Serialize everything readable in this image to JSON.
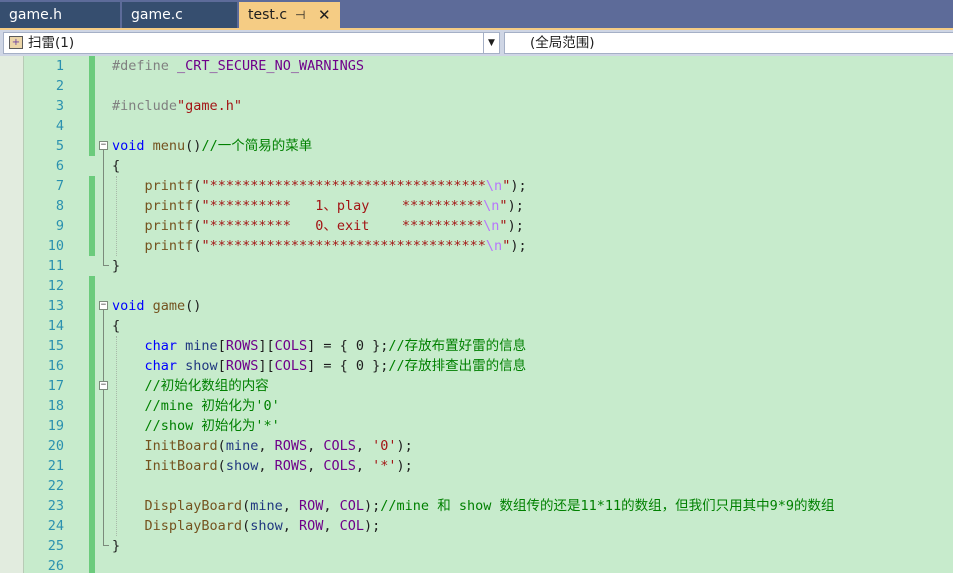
{
  "tabs": [
    {
      "label": "game.h",
      "state": "inactive"
    },
    {
      "label": "game.c",
      "state": "inactive"
    },
    {
      "label": "test.c",
      "state": "active"
    }
  ],
  "tab_icons": {
    "pin": "pin-icon",
    "close": "close-icon"
  },
  "nav": {
    "project_scope": "扫雷(1)",
    "member_scope": "(全局范围)"
  },
  "colors": {
    "tab_bar": "#5d6b99",
    "active_tab": "#f5cc84",
    "editor_background": "#c7ebcc",
    "line_number": "#2b91af",
    "keyword": "#0000ff",
    "string": "#a31515",
    "comment": "#008000",
    "macro": "#6f008a",
    "change_marker": "#6bcb7c"
  },
  "editor": {
    "lines": [
      {
        "n": "1",
        "changed": true,
        "tokens": [
          {
            "t": "#define ",
            "c": "pp"
          },
          {
            "t": "_CRT_SECURE_NO_WARNINGS",
            "c": "mac"
          }
        ]
      },
      {
        "n": "2",
        "changed": true,
        "tokens": []
      },
      {
        "n": "3",
        "changed": true,
        "tokens": [
          {
            "t": "#include",
            "c": "pp"
          },
          {
            "t": "\"game.h\"",
            "c": "str"
          }
        ]
      },
      {
        "n": "4",
        "changed": true,
        "tokens": []
      },
      {
        "n": "5",
        "changed": true,
        "tokens": [
          {
            "t": "void",
            "c": "kw"
          },
          {
            "t": " ",
            "c": "pl"
          },
          {
            "t": "menu",
            "c": "fn"
          },
          {
            "t": "()",
            "c": "pl"
          },
          {
            "t": "//一个简易的菜单",
            "c": "cm"
          }
        ]
      },
      {
        "n": "6",
        "changed": false,
        "tokens": [
          {
            "t": "{",
            "c": "pl"
          }
        ]
      },
      {
        "n": "7",
        "changed": true,
        "tokens": [
          {
            "t": "    ",
            "c": "pl"
          },
          {
            "t": "printf",
            "c": "fn"
          },
          {
            "t": "(",
            "c": "pl"
          },
          {
            "t": "\"**********************************",
            "c": "str"
          },
          {
            "t": "\\n",
            "c": "esc"
          },
          {
            "t": "\"",
            "c": "str"
          },
          {
            "t": ");",
            "c": "pl"
          }
        ]
      },
      {
        "n": "8",
        "changed": true,
        "tokens": [
          {
            "t": "    ",
            "c": "pl"
          },
          {
            "t": "printf",
            "c": "fn"
          },
          {
            "t": "(",
            "c": "pl"
          },
          {
            "t": "\"**********   1、play    **********",
            "c": "str"
          },
          {
            "t": "\\n",
            "c": "esc"
          },
          {
            "t": "\"",
            "c": "str"
          },
          {
            "t": ");",
            "c": "pl"
          }
        ]
      },
      {
        "n": "9",
        "changed": true,
        "tokens": [
          {
            "t": "    ",
            "c": "pl"
          },
          {
            "t": "printf",
            "c": "fn"
          },
          {
            "t": "(",
            "c": "pl"
          },
          {
            "t": "\"**********   0、exit    **********",
            "c": "str"
          },
          {
            "t": "\\n",
            "c": "esc"
          },
          {
            "t": "\"",
            "c": "str"
          },
          {
            "t": ");",
            "c": "pl"
          }
        ]
      },
      {
        "n": "10",
        "changed": true,
        "tokens": [
          {
            "t": "    ",
            "c": "pl"
          },
          {
            "t": "printf",
            "c": "fn"
          },
          {
            "t": "(",
            "c": "pl"
          },
          {
            "t": "\"**********************************",
            "c": "str"
          },
          {
            "t": "\\n",
            "c": "esc"
          },
          {
            "t": "\"",
            "c": "str"
          },
          {
            "t": ");",
            "c": "pl"
          }
        ]
      },
      {
        "n": "11",
        "changed": false,
        "tokens": [
          {
            "t": "}",
            "c": "pl"
          }
        ]
      },
      {
        "n": "12",
        "changed": true,
        "tokens": []
      },
      {
        "n": "13",
        "changed": true,
        "tokens": [
          {
            "t": "void",
            "c": "kw"
          },
          {
            "t": " ",
            "c": "pl"
          },
          {
            "t": "game",
            "c": "fn"
          },
          {
            "t": "()",
            "c": "pl"
          }
        ]
      },
      {
        "n": "14",
        "changed": true,
        "tokens": [
          {
            "t": "{",
            "c": "pl"
          }
        ]
      },
      {
        "n": "15",
        "changed": true,
        "tokens": [
          {
            "t": "    ",
            "c": "pl"
          },
          {
            "t": "char",
            "c": "kw"
          },
          {
            "t": " ",
            "c": "pl"
          },
          {
            "t": "mine",
            "c": "var"
          },
          {
            "t": "[",
            "c": "pl"
          },
          {
            "t": "ROWS",
            "c": "mac"
          },
          {
            "t": "][",
            "c": "pl"
          },
          {
            "t": "COLS",
            "c": "mac"
          },
          {
            "t": "] = { 0 };",
            "c": "pl"
          },
          {
            "t": "//存放布置好雷的信息",
            "c": "cm"
          }
        ]
      },
      {
        "n": "16",
        "changed": true,
        "tokens": [
          {
            "t": "    ",
            "c": "pl"
          },
          {
            "t": "char",
            "c": "kw"
          },
          {
            "t": " ",
            "c": "pl"
          },
          {
            "t": "show",
            "c": "var"
          },
          {
            "t": "[",
            "c": "pl"
          },
          {
            "t": "ROWS",
            "c": "mac"
          },
          {
            "t": "][",
            "c": "pl"
          },
          {
            "t": "COLS",
            "c": "mac"
          },
          {
            "t": "] = { 0 };",
            "c": "pl"
          },
          {
            "t": "//存放排查出雷的信息",
            "c": "cm"
          }
        ]
      },
      {
        "n": "17",
        "changed": true,
        "tokens": [
          {
            "t": "    ",
            "c": "pl"
          },
          {
            "t": "//初始化数组的内容",
            "c": "cm"
          }
        ]
      },
      {
        "n": "18",
        "changed": true,
        "tokens": [
          {
            "t": "    ",
            "c": "pl"
          },
          {
            "t": "//mine 初始化为'0'",
            "c": "cm"
          }
        ]
      },
      {
        "n": "19",
        "changed": true,
        "tokens": [
          {
            "t": "    ",
            "c": "pl"
          },
          {
            "t": "//show 初始化为'*'",
            "c": "cm"
          }
        ]
      },
      {
        "n": "20",
        "changed": true,
        "tokens": [
          {
            "t": "    ",
            "c": "pl"
          },
          {
            "t": "InitBoard",
            "c": "fn"
          },
          {
            "t": "(",
            "c": "pl"
          },
          {
            "t": "mine",
            "c": "var"
          },
          {
            "t": ", ",
            "c": "pl"
          },
          {
            "t": "ROWS",
            "c": "mac"
          },
          {
            "t": ", ",
            "c": "pl"
          },
          {
            "t": "COLS",
            "c": "mac"
          },
          {
            "t": ", ",
            "c": "pl"
          },
          {
            "t": "'0'",
            "c": "str"
          },
          {
            "t": ");",
            "c": "pl"
          }
        ]
      },
      {
        "n": "21",
        "changed": true,
        "tokens": [
          {
            "t": "    ",
            "c": "pl"
          },
          {
            "t": "InitBoard",
            "c": "fn"
          },
          {
            "t": "(",
            "c": "pl"
          },
          {
            "t": "show",
            "c": "var"
          },
          {
            "t": ", ",
            "c": "pl"
          },
          {
            "t": "ROWS",
            "c": "mac"
          },
          {
            "t": ", ",
            "c": "pl"
          },
          {
            "t": "COLS",
            "c": "mac"
          },
          {
            "t": ", ",
            "c": "pl"
          },
          {
            "t": "'*'",
            "c": "str"
          },
          {
            "t": ");",
            "c": "pl"
          }
        ]
      },
      {
        "n": "22",
        "changed": true,
        "tokens": []
      },
      {
        "n": "23",
        "changed": true,
        "tokens": [
          {
            "t": "    ",
            "c": "pl"
          },
          {
            "t": "DisplayBoard",
            "c": "fn"
          },
          {
            "t": "(",
            "c": "pl"
          },
          {
            "t": "mine",
            "c": "var"
          },
          {
            "t": ", ",
            "c": "pl"
          },
          {
            "t": "ROW",
            "c": "mac"
          },
          {
            "t": ", ",
            "c": "pl"
          },
          {
            "t": "COL",
            "c": "mac"
          },
          {
            "t": ");",
            "c": "pl"
          },
          {
            "t": "//mine 和 show 数组传的还是11*11的数组，但我们只用其中9*9的数组",
            "c": "cm"
          }
        ]
      },
      {
        "n": "24",
        "changed": true,
        "tokens": [
          {
            "t": "    ",
            "c": "pl"
          },
          {
            "t": "DisplayBoard",
            "c": "fn"
          },
          {
            "t": "(",
            "c": "pl"
          },
          {
            "t": "show",
            "c": "var"
          },
          {
            "t": ", ",
            "c": "pl"
          },
          {
            "t": "ROW",
            "c": "mac"
          },
          {
            "t": ", ",
            "c": "pl"
          },
          {
            "t": "COL",
            "c": "mac"
          },
          {
            "t": ");",
            "c": "pl"
          }
        ]
      },
      {
        "n": "25",
        "changed": true,
        "tokens": [
          {
            "t": "}",
            "c": "pl"
          }
        ]
      },
      {
        "n": "26",
        "changed": true,
        "tokens": []
      }
    ]
  }
}
